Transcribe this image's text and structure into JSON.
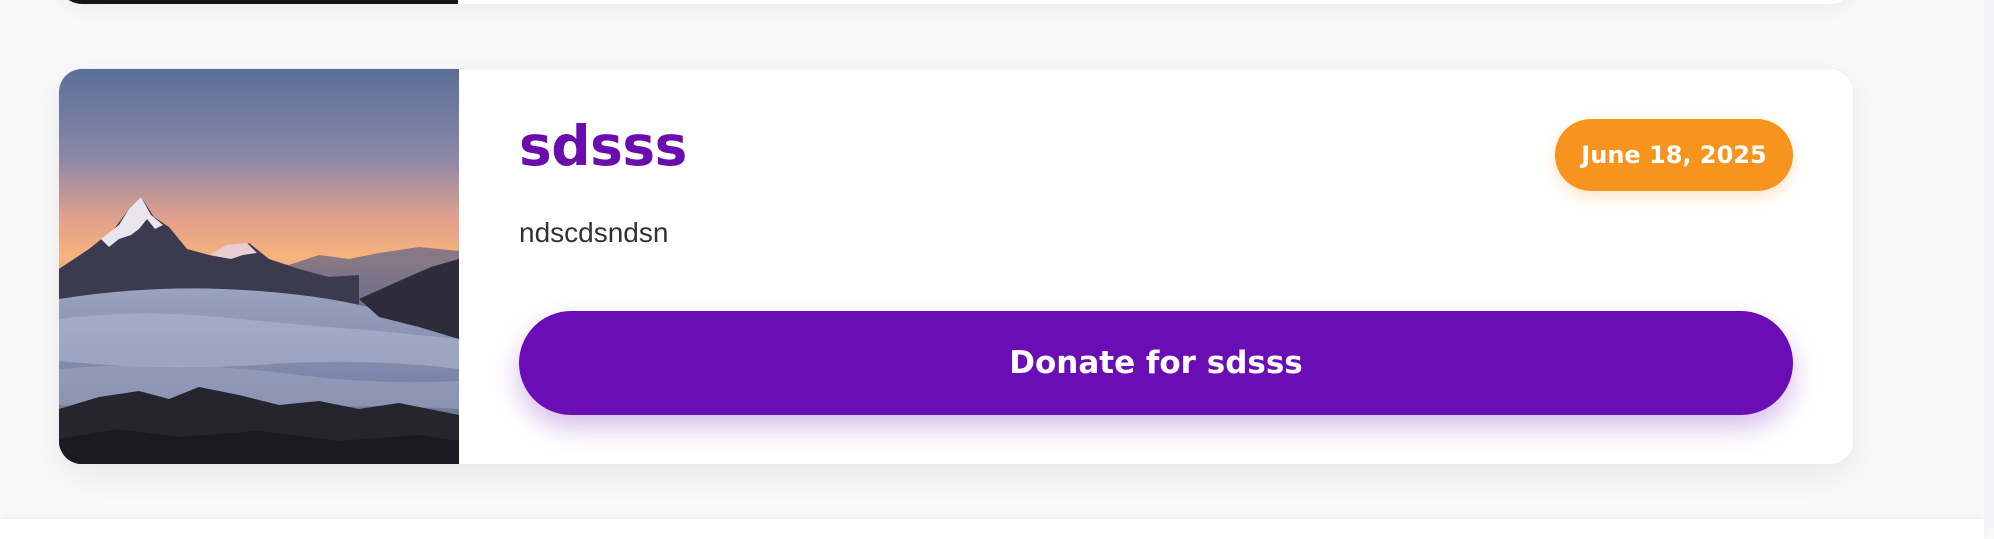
{
  "event": {
    "title": "sdsss",
    "date": "June 18, 2025",
    "description": "ndscdsndsn",
    "donate_label": "Donate for sdsss",
    "image_icon": "mountain-landscape-image"
  },
  "colors": {
    "title": "#6a0dad",
    "button": "#6a0db4",
    "badge": "#f7941e",
    "card": "#ffffff",
    "page": "#f9f9fa"
  }
}
